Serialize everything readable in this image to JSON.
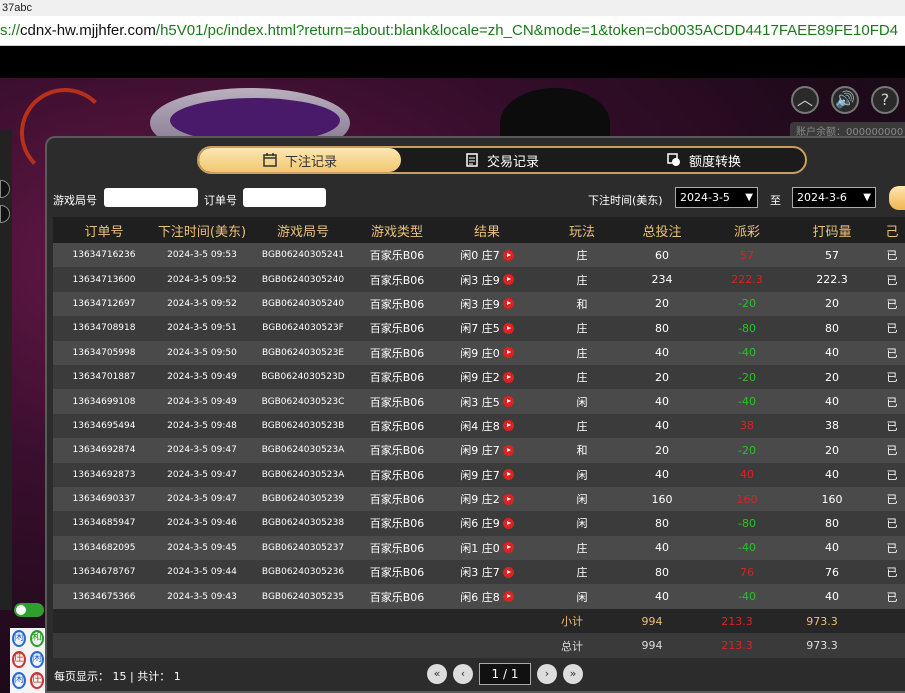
{
  "window": {
    "title": "37abc"
  },
  "address": {
    "scheme_partial": "s://",
    "host": "cdnx-hw.mjjhfer.com",
    "path": "/h5V01/pc/index.html?return=about:blank&locale=zh_CN&mode=1&token=cb0035ACDD4417FAEE89FE10FD4"
  },
  "game": {
    "user_pill": "账户余额：000000000"
  },
  "tabs": [
    {
      "label": "下注记录",
      "icon": "calendar-icon",
      "active": true
    },
    {
      "label": "交易记录",
      "icon": "document-icon",
      "active": false
    },
    {
      "label": "额度转换",
      "icon": "exchange-icon",
      "active": false
    }
  ],
  "filter": {
    "round_label": "游戏局号",
    "order_label": "订单号",
    "time_label": "下注时间(美东)",
    "from_date": "2024-3-5",
    "to_label": "至",
    "to_date": "2024-3-6"
  },
  "table": {
    "headers": [
      "订单号",
      "下注时间(美东)",
      "游戏局号",
      "游戏类型",
      "结果",
      "玩法",
      "总投注",
      "派彩",
      "打码量",
      "己"
    ],
    "rows": [
      {
        "order": "13634716236",
        "time": "2024-3-5 09:53",
        "round": "BGB06240305241",
        "type": "百家乐B06",
        "result": "闲0 庄7",
        "bet": "庄",
        "total": "60",
        "payout": "57",
        "payout_sign": "neg",
        "valid": "57",
        "status": "已"
      },
      {
        "order": "13634713600",
        "time": "2024-3-5 09:52",
        "round": "BGB06240305240",
        "type": "百家乐B06",
        "result": "闲3 庄9",
        "bet": "庄",
        "total": "234",
        "payout": "222.3",
        "payout_sign": "neg",
        "valid": "222.3",
        "status": "已"
      },
      {
        "order": "13634712697",
        "time": "2024-3-5 09:52",
        "round": "BGB06240305240",
        "type": "百家乐B06",
        "result": "闲3 庄9",
        "bet": "和",
        "total": "20",
        "payout": "-20",
        "payout_sign": "pos",
        "valid": "20",
        "status": "已"
      },
      {
        "order": "13634708918",
        "time": "2024-3-5 09:51",
        "round": "BGB0624030523F",
        "type": "百家乐B06",
        "result": "闲7 庄5",
        "bet": "庄",
        "total": "80",
        "payout": "-80",
        "payout_sign": "pos",
        "valid": "80",
        "status": "已"
      },
      {
        "order": "13634705998",
        "time": "2024-3-5 09:50",
        "round": "BGB0624030523E",
        "type": "百家乐B06",
        "result": "闲9 庄0",
        "bet": "庄",
        "total": "40",
        "payout": "-40",
        "payout_sign": "pos",
        "valid": "40",
        "status": "已"
      },
      {
        "order": "13634701887",
        "time": "2024-3-5 09:49",
        "round": "BGB0624030523D",
        "type": "百家乐B06",
        "result": "闲9 庄2",
        "bet": "庄",
        "total": "20",
        "payout": "-20",
        "payout_sign": "pos",
        "valid": "20",
        "status": "已"
      },
      {
        "order": "13634699108",
        "time": "2024-3-5 09:49",
        "round": "BGB0624030523C",
        "type": "百家乐B06",
        "result": "闲3 庄5",
        "bet": "闲",
        "total": "40",
        "payout": "-40",
        "payout_sign": "pos",
        "valid": "40",
        "status": "已"
      },
      {
        "order": "13634695494",
        "time": "2024-3-5 09:48",
        "round": "BGB0624030523B",
        "type": "百家乐B06",
        "result": "闲4 庄8",
        "bet": "庄",
        "total": "40",
        "payout": "38",
        "payout_sign": "neg",
        "valid": "38",
        "status": "已"
      },
      {
        "order": "13634692874",
        "time": "2024-3-5 09:47",
        "round": "BGB0624030523A",
        "type": "百家乐B06",
        "result": "闲9 庄7",
        "bet": "和",
        "total": "20",
        "payout": "-20",
        "payout_sign": "pos",
        "valid": "20",
        "status": "已"
      },
      {
        "order": "13634692873",
        "time": "2024-3-5 09:47",
        "round": "BGB0624030523A",
        "type": "百家乐B06",
        "result": "闲9 庄7",
        "bet": "闲",
        "total": "40",
        "payout": "40",
        "payout_sign": "neg",
        "valid": "40",
        "status": "已"
      },
      {
        "order": "13634690337",
        "time": "2024-3-5 09:47",
        "round": "BGB06240305239",
        "type": "百家乐B06",
        "result": "闲9 庄2",
        "bet": "闲",
        "total": "160",
        "payout": "160",
        "payout_sign": "neg",
        "valid": "160",
        "status": "已"
      },
      {
        "order": "13634685947",
        "time": "2024-3-5 09:46",
        "round": "BGB06240305238",
        "type": "百家乐B06",
        "result": "闲6 庄9",
        "bet": "闲",
        "total": "80",
        "payout": "-80",
        "payout_sign": "pos",
        "valid": "80",
        "status": "已"
      },
      {
        "order": "13634682095",
        "time": "2024-3-5 09:45",
        "round": "BGB06240305237",
        "type": "百家乐B06",
        "result": "闲1 庄0",
        "bet": "庄",
        "total": "40",
        "payout": "-40",
        "payout_sign": "pos",
        "valid": "40",
        "status": "已"
      },
      {
        "order": "13634678767",
        "time": "2024-3-5 09:44",
        "round": "BGB06240305236",
        "type": "百家乐B06",
        "result": "闲3 庄7",
        "bet": "庄",
        "total": "80",
        "payout": "76",
        "payout_sign": "neg",
        "valid": "76",
        "status": "已"
      },
      {
        "order": "13634675366",
        "time": "2024-3-5 09:43",
        "round": "BGB06240305235",
        "type": "百家乐B06",
        "result": "闲6 庄8",
        "bet": "闲",
        "total": "40",
        "payout": "-40",
        "payout_sign": "pos",
        "valid": "40",
        "status": "已"
      }
    ],
    "subtotal": {
      "label": "小计",
      "total": "994",
      "payout": "213.3",
      "valid": "973.3"
    },
    "grandtotal": {
      "label": "总计",
      "total": "994",
      "payout": "213.3",
      "valid": "973.3"
    }
  },
  "footer": {
    "per_page_label": "每页显示：",
    "per_page": "15",
    "sep": "|",
    "count_label": "共计：",
    "count": "1",
    "page_display": "1 / 1"
  },
  "colors": {
    "accent_gold": "#e9c17a",
    "negative": "#dd2222",
    "positive": "#2ac02a"
  }
}
